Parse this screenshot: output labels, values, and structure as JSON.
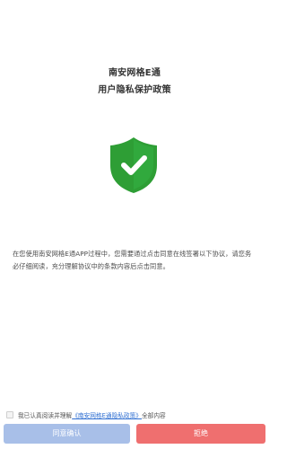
{
  "header": {
    "app_title": "南安网格E通",
    "policy_title": "用户隐私保护政策"
  },
  "hero": {
    "icon": "shield-check-icon",
    "shield_color": "#2e9e35",
    "check_color": "#ffffff"
  },
  "body": {
    "policy_text": "在您使用南安网格E通APP过程中，您需要通过点击同意在线签署以下协议，请您务必仔细阅读，充分理解协议中的条款内容后点击同意。"
  },
  "footer": {
    "checkbox_checked": false,
    "agree_prefix": "我已认真阅读并理解",
    "agree_link": "《南安网格E通隐私政策》",
    "agree_suffix": "全部内容",
    "agree_button": "同意确认",
    "reject_button": "拒绝"
  },
  "colors": {
    "agree_button": "#a8bfe8",
    "reject_button": "#ef6f6f",
    "link": "#2f6fd2"
  }
}
